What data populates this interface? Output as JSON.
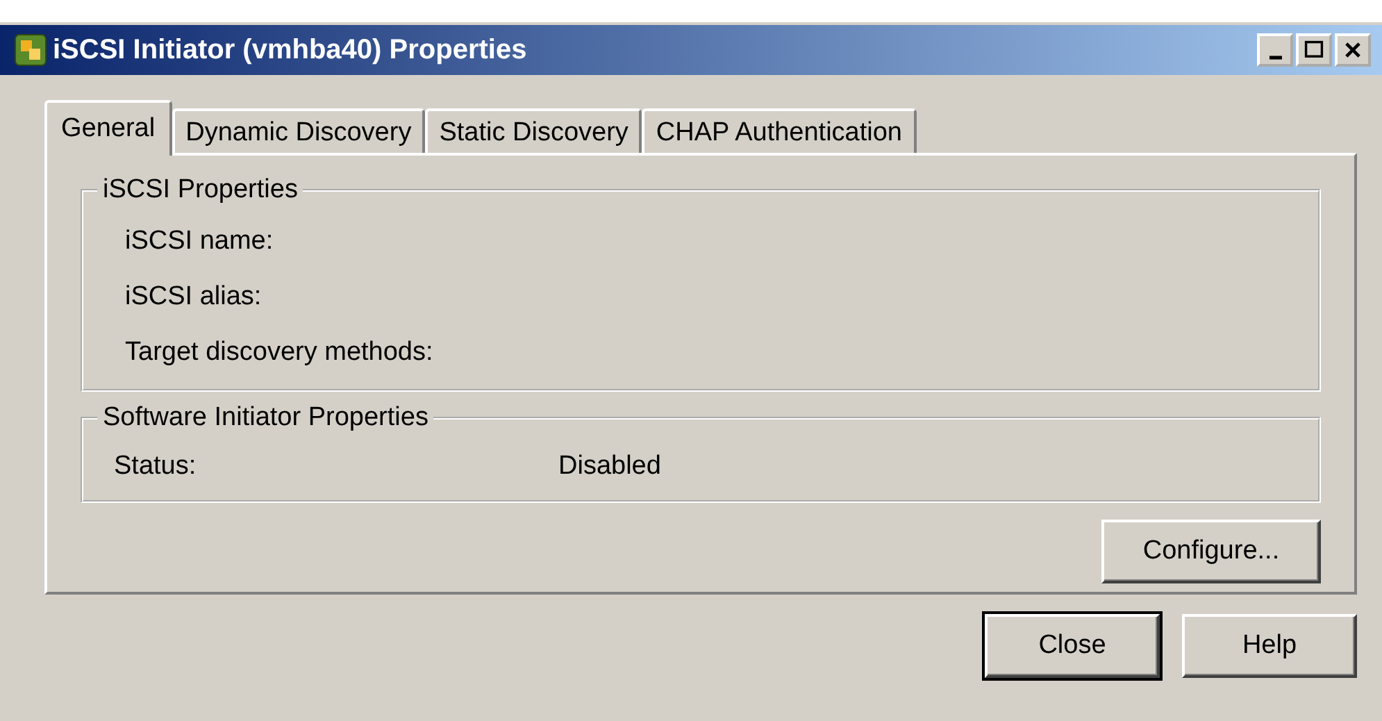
{
  "window": {
    "title": "iSCSI Initiator (vmhba40) Properties"
  },
  "title_buttons": [
    {
      "kind": "minimize"
    },
    {
      "kind": "maximize"
    },
    {
      "kind": "close"
    }
  ],
  "tabs": [
    {
      "label": "General",
      "selected": true
    },
    {
      "label": "Dynamic Discovery",
      "selected": false
    },
    {
      "label": "Static Discovery",
      "selected": false
    },
    {
      "label": "CHAP Authentication",
      "selected": false
    }
  ],
  "groups": [
    {
      "title": "iSCSI Properties",
      "rows": [
        {
          "label": "iSCSI name:"
        },
        {
          "label": "iSCSI alias:"
        },
        {
          "label": "Target discovery methods:"
        }
      ]
    },
    {
      "title": "Software Initiator Properties",
      "rows": [
        {
          "label": "Status:",
          "value": "Disabled"
        }
      ]
    }
  ],
  "configure_button": "Configure...",
  "buttons": [
    {
      "label": "Close",
      "default": true
    },
    {
      "label": "Help",
      "default": false
    }
  ]
}
